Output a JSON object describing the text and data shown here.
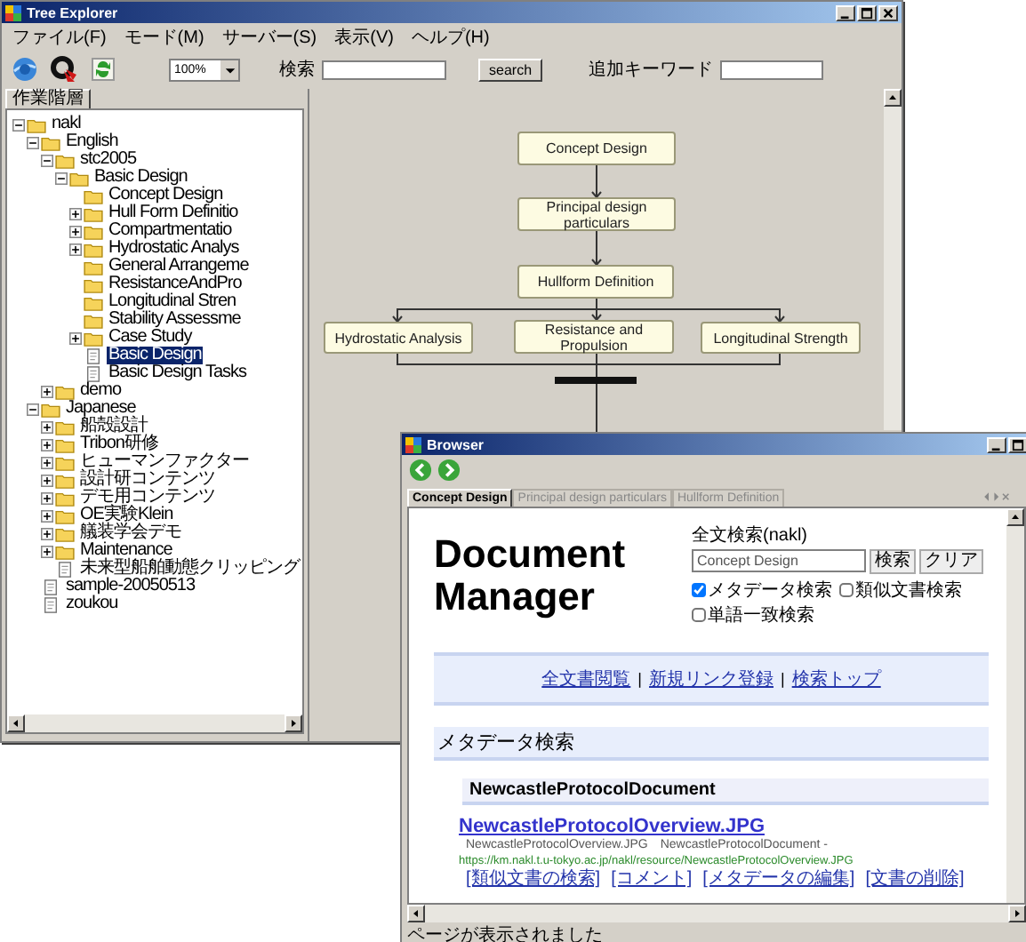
{
  "main_window": {
    "title": "Tree Explorer",
    "menu": [
      "ファイル(F)",
      "モード(M)",
      "サーバー(S)",
      "表示(V)",
      "ヘルプ(H)"
    ],
    "toolbar": {
      "zoom": "100%",
      "search_label": "検索",
      "search_button": "search",
      "keyword_label": "追加キーワード"
    },
    "panel_tab": "作業階層",
    "tree": [
      {
        "label": "nakl",
        "kind": "folder",
        "expanded": true,
        "selected": false,
        "children": [
          {
            "label": "English",
            "kind": "folder",
            "expanded": true,
            "selected": false,
            "children": [
              {
                "label": "stc2005",
                "kind": "folder",
                "expanded": true,
                "selected": false,
                "children": [
                  {
                    "label": "Basic Design",
                    "kind": "folder",
                    "expanded": true,
                    "selected": false,
                    "children": [
                      {
                        "label": "Concept Design",
                        "kind": "folder",
                        "selected": false
                      },
                      {
                        "label": "Hull Form Definitio",
                        "kind": "folder",
                        "expanded": false,
                        "selected": false
                      },
                      {
                        "label": "Compartmentatio",
                        "kind": "folder",
                        "expanded": false,
                        "selected": false
                      },
                      {
                        "label": "Hydrostatic Analys",
                        "kind": "folder",
                        "expanded": false,
                        "selected": false
                      },
                      {
                        "label": "General Arrangeme",
                        "kind": "folder",
                        "selected": false
                      },
                      {
                        "label": "ResistanceAndPro",
                        "kind": "folder",
                        "selected": false
                      },
                      {
                        "label": "Longitudinal Stren",
                        "kind": "folder",
                        "selected": false
                      },
                      {
                        "label": "Stability Assessme",
                        "kind": "folder",
                        "selected": false
                      },
                      {
                        "label": "Case Study",
                        "kind": "folder",
                        "expanded": false,
                        "selected": false
                      },
                      {
                        "label": "Basic Design",
                        "kind": "page",
                        "selected": true
                      },
                      {
                        "label": "Basic Design Tasks",
                        "kind": "page",
                        "selected": false
                      }
                    ]
                  }
                ]
              },
              {
                "label": "demo",
                "kind": "folder",
                "expanded": false,
                "selected": false
              }
            ]
          },
          {
            "label": "Japanese",
            "kind": "folder",
            "expanded": true,
            "selected": false,
            "children": [
              {
                "label": "船殻設計",
                "kind": "folder",
                "expanded": false,
                "selected": false
              },
              {
                "label": "Tribon研修",
                "kind": "folder",
                "expanded": false,
                "selected": false
              },
              {
                "label": "ヒューマンファクター",
                "kind": "folder",
                "expanded": false,
                "selected": false
              },
              {
                "label": "設計研コンテンツ",
                "kind": "folder",
                "expanded": false,
                "selected": false
              },
              {
                "label": "デモ用コンテンツ",
                "kind": "folder",
                "expanded": false,
                "selected": false
              },
              {
                "label": "OE実験Klein",
                "kind": "folder",
                "expanded": false,
                "selected": false
              },
              {
                "label": "艤装学会デモ",
                "kind": "folder",
                "expanded": false,
                "selected": false
              },
              {
                "label": "Maintenance",
                "kind": "folder",
                "expanded": false,
                "selected": false
              },
              {
                "label": "未来型船舶動態クリッピング",
                "kind": "page",
                "selected": false
              }
            ]
          },
          {
            "label": "sample-20050513",
            "kind": "page",
            "selected": false
          },
          {
            "label": "zoukou",
            "kind": "page",
            "selected": false
          }
        ]
      }
    ],
    "diagram": [
      {
        "label": "Concept Design"
      },
      {
        "label": "Principal design particulars"
      },
      {
        "label": "Hullform Definition"
      },
      {
        "label": "Hydrostatic Analysis"
      },
      {
        "label": "Resistance and Propulsion"
      },
      {
        "label": "Longitudinal Strength"
      }
    ]
  },
  "browser": {
    "title": "Browser",
    "tabs": [
      {
        "label": "Concept Design",
        "selected": true
      },
      {
        "label": "Principal design particulars",
        "selected": false
      },
      {
        "label": "Hullform Definition",
        "selected": false
      }
    ],
    "page": {
      "heading": "Document Manager",
      "search_label": "全文検索(nakl)",
      "search_value": "Concept Design",
      "buttons": [
        "検索",
        "クリア"
      ],
      "options": [
        {
          "label": "メタデータ検索",
          "checked": true
        },
        {
          "label": "類似文書検索",
          "checked": false
        },
        {
          "label": "単語一致検索",
          "checked": false
        }
      ],
      "nav_links": [
        "全文書閲覧",
        "新規リンク登録",
        "検索トップ"
      ],
      "nav_separator": "|",
      "section": "メタデータ検索",
      "group": "NewcastleProtocolDocument",
      "result": {
        "title": "NewcastleProtocolOverview.JPG",
        "meta": "NewcastleProtocolOverview.JPG　NewcastleProtocolDocument -",
        "url": "https://km.nakl.t.u-tokyo.ac.jp/nakl/resource/NewcastleProtocolOverview.JPG",
        "actions": [
          "[類似文書の検索]",
          "[コメント]",
          "[メタデータの編集]",
          "[文書の削除]"
        ]
      }
    },
    "status": "ページが表示されました"
  }
}
